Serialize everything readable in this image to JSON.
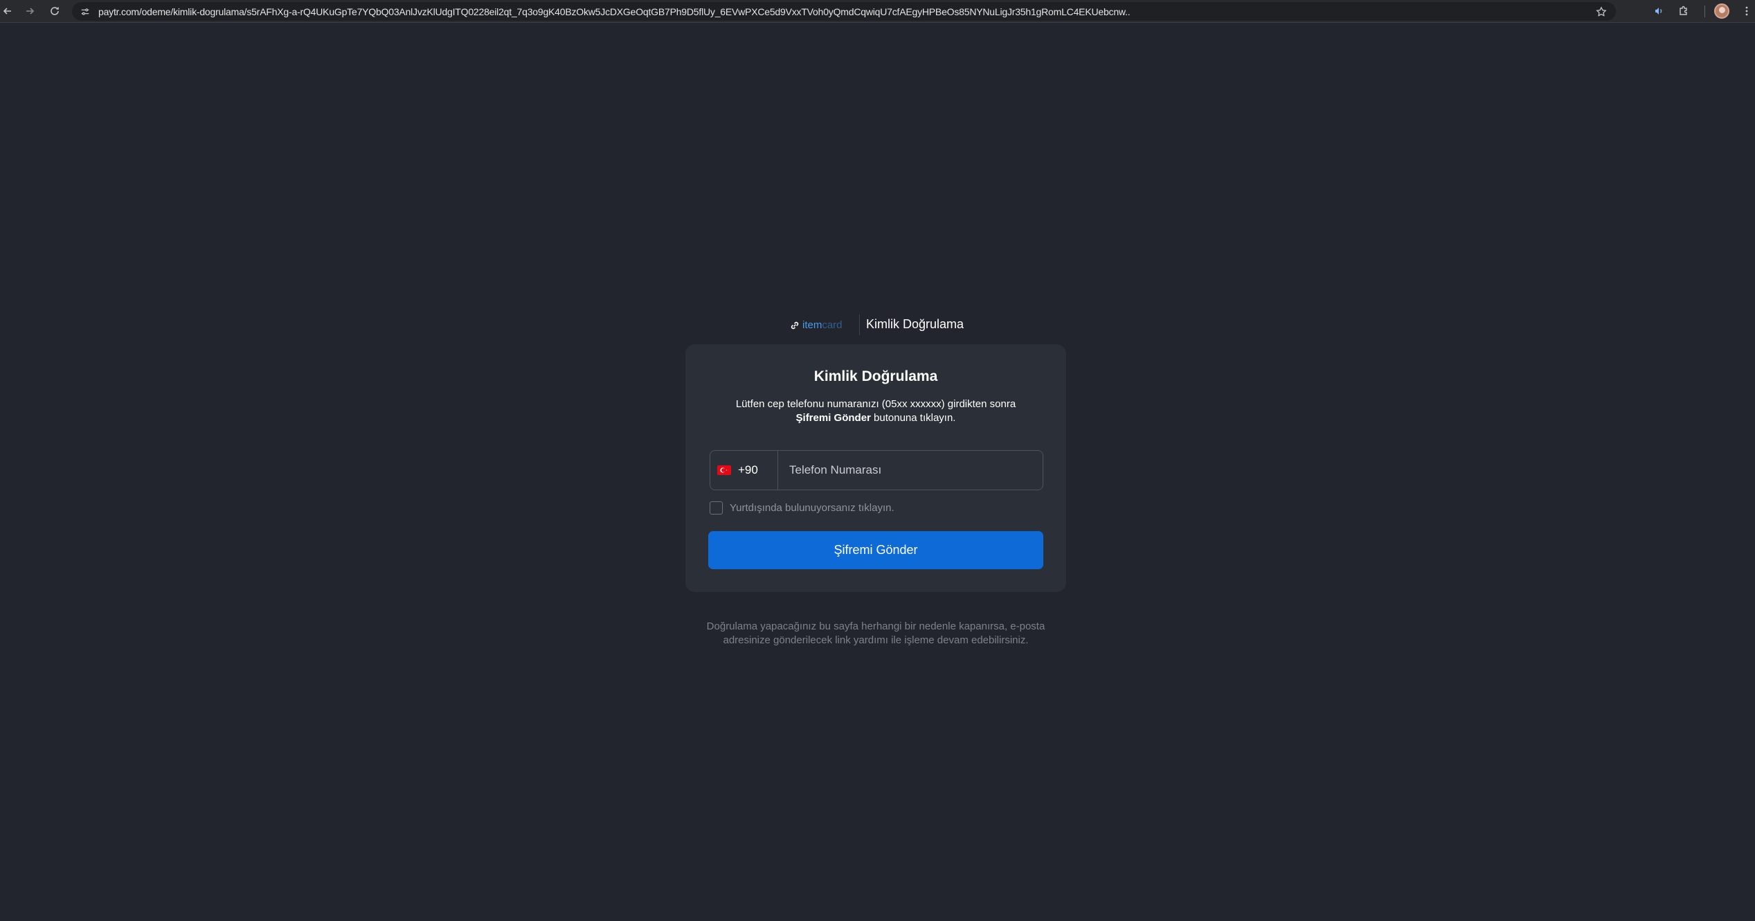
{
  "browser": {
    "url": "paytr.com/odeme/kimlik-dogrulama/s5rAFhXg-a-rQ4UKuGpTe7YQbQ03AnlJvzKlUdgITQ0228eil2qt_7q3o9gK40BzOkw5JcDXGeOqtGB7Ph9D5flUy_6EVwPXCe5d9VxxTVoh0yQmdCqwiqU7cfAEgyHPBeOs85NYNuLigJr35h1gRomLC4EKUebcnw..",
    "icons": [
      "back-icon",
      "forward-icon",
      "refresh-icon",
      "site-settings-icon",
      "star-icon",
      "read-aloud-icon",
      "extensions-icon",
      "profile-avatar",
      "menu-icon"
    ]
  },
  "brand": {
    "logo_text": "item",
    "logo_faded_text": "card",
    "header_title": "Kimlik Doğrulama"
  },
  "card": {
    "title": "Kimlik Doğrulama",
    "desc_line1": "Lütfen cep telefonu numaranızı (05xx xxxxxx) girdikten sonra",
    "desc_bold": "Şifremi Gönder",
    "desc_line2_rest": " butonuna tıklayın.",
    "dial_code": "+90",
    "phone_placeholder": "Telefon Numarası",
    "abroad_label": "Yurtdışında bulunuyorsanız tıklayın.",
    "submit_label": "Şifremi Gönder"
  },
  "footer": {
    "note_line1": "Doğrulama yapacağınız bu sayfa herhangi bir nedenle kapanırsa, e-posta",
    "note_line2": "adresinize gönderilecek link yardımı ile işleme devam edebilirsiniz."
  },
  "colors": {
    "page_bg": "#22252d",
    "card_bg": "#2b2f37",
    "accent": "#0e6ad6",
    "flag_red": "#e30a17"
  }
}
